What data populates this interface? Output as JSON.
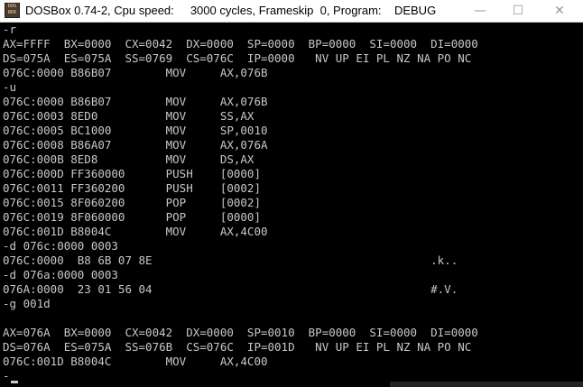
{
  "window": {
    "title": "DOSBox 0.74-2, Cpu speed:     3000 cycles, Frameskip  0, Program:    DEBUG",
    "icon_text": "DOS BOX",
    "icon": "dosbox-app-icon",
    "controls": {
      "minimize": "—",
      "maximize": "☐",
      "close": "✕"
    }
  },
  "terminal": {
    "lines": [
      "-r",
      "AX=FFFF  BX=0000  CX=0042  DX=0000  SP=0000  BP=0000  SI=0000  DI=0000",
      "DS=075A  ES=075A  SS=0769  CS=076C  IP=0000   NV UP EI PL NZ NA PO NC",
      "076C:0000 B86B07        MOV     AX,076B",
      "-u",
      "076C:0000 B86B07        MOV     AX,076B",
      "076C:0003 8ED0          MOV     SS,AX",
      "076C:0005 BC1000        MOV     SP,0010",
      "076C:0008 B86A07        MOV     AX,076A",
      "076C:000B 8ED8          MOV     DS,AX",
      "076C:000D FF360000      PUSH    [0000]",
      "076C:0011 FF360200      PUSH    [0002]",
      "076C:0015 8F060200      POP     [0002]",
      "076C:0019 8F060000      POP     [0000]",
      "076C:001D B8004C        MOV     AX,4C00",
      "-d 076c:0000 0003",
      "076C:0000  B8 6B 07 8E                                         .k..",
      "-d 076a:0000 0003",
      "076A:0000  23 01 56 04                                         #.V.",
      "-g 001d",
      "",
      "AX=076A  BX=0000  CX=0042  DX=0000  SP=0010  BP=0000  SI=0000  DI=0000",
      "DS=076A  ES=075A  SS=076B  CS=076C  IP=001D   NV UP EI PL NZ NA PO NC",
      "076C:001D B8004C        MOV     AX,4C00",
      "-"
    ]
  },
  "colors": {
    "background": "#000000",
    "text": "#c8c8c8",
    "titlebar": "#ffffff"
  }
}
